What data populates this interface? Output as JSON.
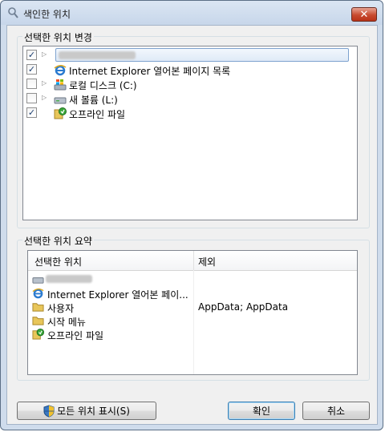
{
  "window": {
    "title": "색인한 위치",
    "close_label": "✕"
  },
  "change_group": {
    "label": "선택한 위치 변경",
    "items": [
      {
        "label": "",
        "checked": true,
        "icon": "blurred-drive-icon",
        "selected": true
      },
      {
        "label": "Internet Explorer 열어본 페이지 목록",
        "checked": true,
        "icon": "internet-explorer-icon"
      },
      {
        "label": "로컬 디스크 (C:)",
        "checked": false,
        "icon": "windows-drive-icon"
      },
      {
        "label": "새 볼륨 (L:)",
        "checked": false,
        "icon": "drive-icon"
      },
      {
        "label": "오프라인 파일",
        "checked": true,
        "icon": "offline-files-icon"
      }
    ]
  },
  "summary_group": {
    "label": "선택한 위치 요약",
    "columns": [
      "선택한 위치",
      "제외"
    ],
    "rows": [
      {
        "location": "",
        "exclude": "",
        "icon": "blurred-drive-icon"
      },
      {
        "location": "Internet Explorer 열어본 페이...",
        "exclude": "",
        "icon": "internet-explorer-icon"
      },
      {
        "location": "사용자",
        "exclude": "AppData; AppData",
        "icon": "folder-icon"
      },
      {
        "location": "시작 메뉴",
        "exclude": "",
        "icon": "folder-icon"
      },
      {
        "location": "오프라인 파일",
        "exclude": "",
        "icon": "offline-files-icon"
      }
    ]
  },
  "buttons": {
    "show_all": "모든 위치 표시(S)",
    "ok": "확인",
    "cancel": "취소"
  }
}
